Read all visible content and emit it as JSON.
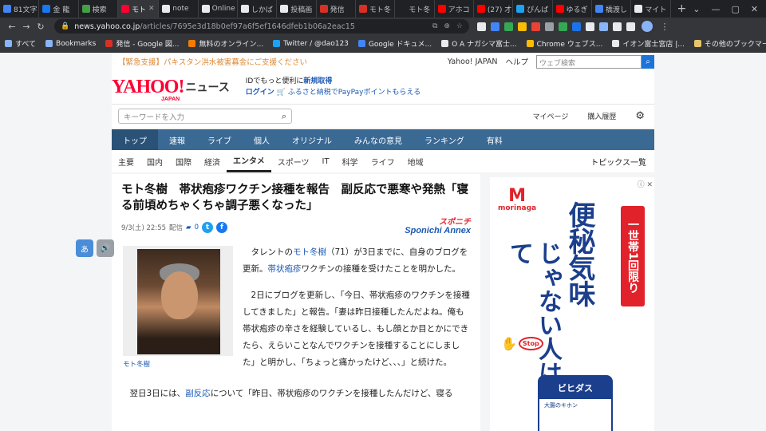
{
  "browser": {
    "tabs": [
      {
        "title": "81文字",
        "color": "#4285f4"
      },
      {
        "title": "金 龍",
        "color": "#1877f2"
      },
      {
        "title": "検索",
        "color": "#43a047"
      },
      {
        "title": "モト",
        "color": "#ff0033",
        "active": true
      },
      {
        "title": "note",
        "color": "#e8eaed"
      },
      {
        "title": "Online",
        "color": "#e8eaed"
      },
      {
        "title": "しかば",
        "color": "#e8eaed"
      },
      {
        "title": "投稿画",
        "color": "#e8eaed"
      },
      {
        "title": "発信",
        "color": "#d93025"
      },
      {
        "title": "モト冬",
        "color": "#d93025"
      },
      {
        "title": "モト冬",
        "color": "#202124"
      },
      {
        "title": "アホコ",
        "color": "#ff0000"
      },
      {
        "title": "(27) 才",
        "color": "#ff0000"
      },
      {
        "title": "ぴんば",
        "color": "#1da1f2"
      },
      {
        "title": "ゆるぎ",
        "color": "#ff0000"
      },
      {
        "title": "橋渡し",
        "color": "#4285f4"
      },
      {
        "title": "マイト",
        "color": "#e8eaed"
      }
    ],
    "url_host": "news.yahoo.co.jp",
    "url_path": "/articles/7695e3d18b0ef97a6f5ef1646dfeb1b06a2eac15",
    "bookmarks": [
      "すべて",
      "Bookmarks",
      "発信 - Google 図...",
      "無料のオンライン...",
      "Twitter / @dao123",
      "Google ドキュメ...",
      "O A ナガシマ富士...",
      "Chrome ウェブス...",
      "イオン富士宮店 |..."
    ],
    "bookmarks_other": "その他のブックマーク"
  },
  "yahoo": {
    "alert": "【緊急支援】パキスタン洪水被害募金にご支援ください",
    "top_links": [
      "Yahoo! JAPAN",
      "ヘルプ"
    ],
    "search_placeholder": "ウェブ検索",
    "logo": "YAHOO!",
    "logo_sub": "JAPAN",
    "news_label": "ニュース",
    "id_text": "IDでもっと便利に",
    "register": "新規取得",
    "login": "ログイン",
    "furusato": "ふるさと納税でPayPayポイントもらえる",
    "kw_placeholder": "キーワードを入力",
    "mypage": "マイページ",
    "history": "購入履歴",
    "gnav": [
      "トップ",
      "速報",
      "ライブ",
      "個人",
      "オリジナル",
      "みんなの意見",
      "ランキング",
      "有料"
    ],
    "subnav": [
      "主要",
      "国内",
      "国際",
      "経済",
      "エンタメ",
      "スポーツ",
      "IT",
      "科学",
      "ライフ",
      "地域"
    ],
    "topics": "トピックス一覧"
  },
  "article": {
    "headline": "モト冬樹　帯状疱疹ワクチン接種を報告　副反応で悪寒や発熱「寝る前頃めちゃくちゃ調子悪くなった」",
    "date": "9/3(土) 22:55",
    "dist": "配信",
    "comments": "0",
    "source_top": "スポニチ",
    "source": "Sponichi Annex",
    "caption": "モト冬樹",
    "p1_a": "タレントの",
    "p1_link": "モト冬樹",
    "p1_b": "（71）が3日までに、自身のブログを更新。",
    "p1_link2": "帯状疱疹",
    "p1_c": "ワクチンの接種を受けたことを明かした。",
    "p2": "2日にブログを更新し、「今日、帯状疱疹のワクチンを接種してきました」と報告。「妻は昨日接種したんだよね。俺も帯状疱疹の辛さを経験しているし、もし顔とか目とかにできたら、えらいことなんでワクチンを接種することにしました」と明かし、「ちょっと痛かったけど、、、」と続けた。",
    "p3_a": "翌日3日には、",
    "p3_link": "副反応",
    "p3_b": "について「昨日、帯状疱疹のワクチンを接種したんだけど、寝る"
  },
  "ad": {
    "brand": "morinaga",
    "copy1": "便秘気味",
    "copy2": "じゃない人はやめて",
    "badge": "一世帯1回限り",
    "stop": "Stop",
    "pack": "ビヒダス",
    "pack_sub": "大腸のキホン"
  }
}
